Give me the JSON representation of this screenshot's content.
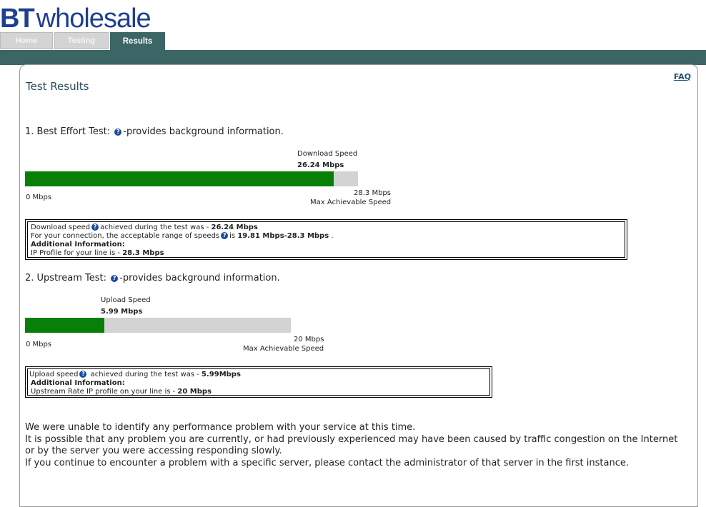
{
  "header": {
    "logo_bt": "BT",
    "logo_wholesale": "wholesale",
    "tabs": [
      {
        "label": "Home",
        "active": false
      },
      {
        "label": "Testing",
        "active": false
      },
      {
        "label": "Results",
        "active": true
      }
    ],
    "brand_color": "#3c6666"
  },
  "page": {
    "faq": "FAQ",
    "title": "Test Results"
  },
  "best_effort": {
    "heading_prefix": "1. Best Effort Test:",
    "heading_suffix": "-provides background information.",
    "speed_label": "Download Speed",
    "speed_value": "26.24 Mbps",
    "min_label": "0 Mbps",
    "max_value": "28.3 Mbps",
    "max_label": "Max Achievable Speed",
    "fill_fraction": 0.927,
    "info": {
      "line1_text": "Download speed",
      "line1_mid": "achieved during the test was - ",
      "line1_value": "26.24 Mbps",
      "line2_text": "For your connection, the acceptable range of speeds",
      "line2_mid": "is ",
      "line2_value": "19.81 Mbps-28.3 Mbps",
      "line2_end": " .",
      "line3": "Additional Information:",
      "line4_text": "IP Profile for your line is - ",
      "line4_value": "28.3 Mbps"
    }
  },
  "upstream": {
    "heading_prefix": "2. Upstream Test:",
    "heading_suffix": "-provides background information.",
    "speed_label": "Upload Speed",
    "speed_value": "5.99 Mbps",
    "min_label": "0 Mbps",
    "max_value": "20 Mbps",
    "max_label": "Max Achievable Speed",
    "fill_fraction": 0.2995,
    "info": {
      "line1_text": "Upload speed",
      "line1_mid": " achieved during the test was - ",
      "line1_value": "5.99Mbps",
      "line2": "Additional Information:",
      "line3_text": "Upstream Rate IP profile on your line is - ",
      "line3_value": "20 Mbps"
    }
  },
  "summary": {
    "p1": "We were unable to identify any performance problem with your service at this time.",
    "p2": "It is possible that any problem you are currently, or had previously experienced may have been caused by traffic congestion on the Internet or by the server you were accessing responding slowly.",
    "p3": "If you continue to encounter a problem with a specific server, please contact the administrator of that server in the first instance."
  }
}
